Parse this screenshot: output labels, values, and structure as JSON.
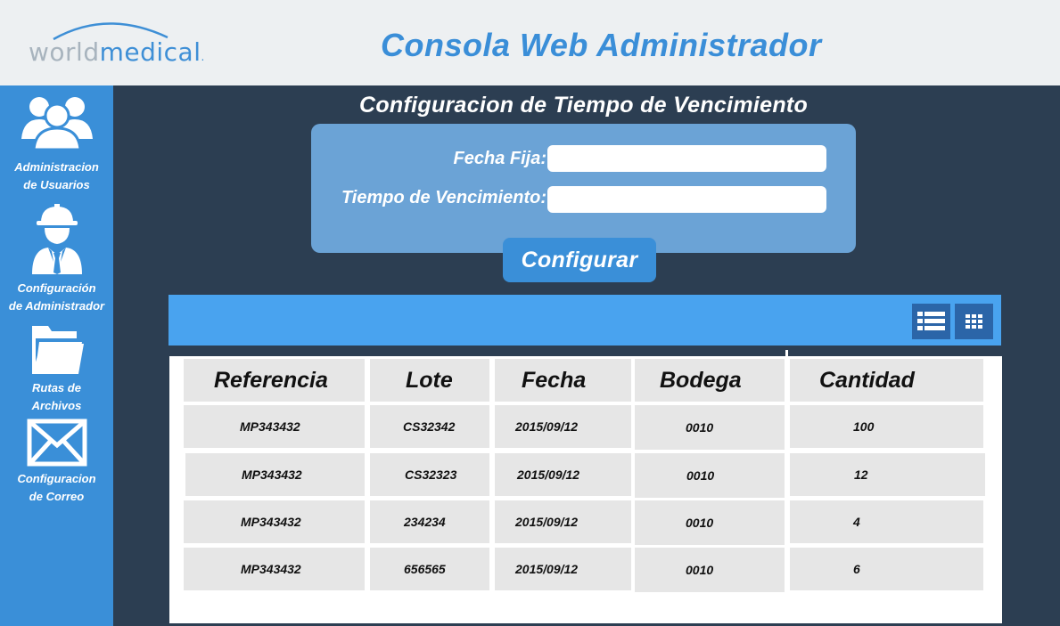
{
  "app": {
    "logo_world": "world",
    "logo_medical": "medical",
    "logo_reg": ".",
    "title": "Consola Web Administrador"
  },
  "sidebar": {
    "items": [
      {
        "label_line1": "Administracion",
        "label_line2": "de Usuarios",
        "icon": "users-icon"
      },
      {
        "label_line1": "Configuración",
        "label_line2": "de Administrador",
        "icon": "admin-worker-icon"
      },
      {
        "label_line1": "Rutas de",
        "label_line2": "Archivos",
        "icon": "folder-icon"
      },
      {
        "label_line1": "Configuracion",
        "label_line2": "de Correo",
        "icon": "mail-icon"
      }
    ]
  },
  "config": {
    "title": "Configuracion de Tiempo de Vencimiento",
    "fecha_fija_label": "Fecha Fija:",
    "fecha_fija_value": "",
    "tiempo_label": "Tiempo de Vencimiento:",
    "tiempo_value": "",
    "button_label": "Configurar"
  },
  "table": {
    "view_buttons": [
      "list-view-icon",
      "grid-view-icon"
    ],
    "columns": [
      "Referencia",
      "Lote",
      "Fecha",
      "Bodega",
      "Cantidad"
    ],
    "rows": [
      [
        "MP343432",
        "CS32342",
        "2015/09/12",
        "0010",
        "100"
      ],
      [
        "MP343432",
        "CS32323",
        "2015/09/12",
        "0010",
        "12"
      ],
      [
        "MP343432",
        "234234",
        "2015/09/12",
        "0010",
        "4"
      ],
      [
        "MP343432",
        "656565",
        "2015/09/12",
        "0010",
        "6"
      ]
    ]
  },
  "colors": {
    "header_bg": "#edf0f2",
    "title_blue": "#3a8ed8",
    "sidebar_bg": "#3a8fd8",
    "main_bg": "#2c3e52",
    "form_panel": "#6ba3d6",
    "table_bar": "#49a3ef",
    "view_button": "#2b65a8"
  }
}
